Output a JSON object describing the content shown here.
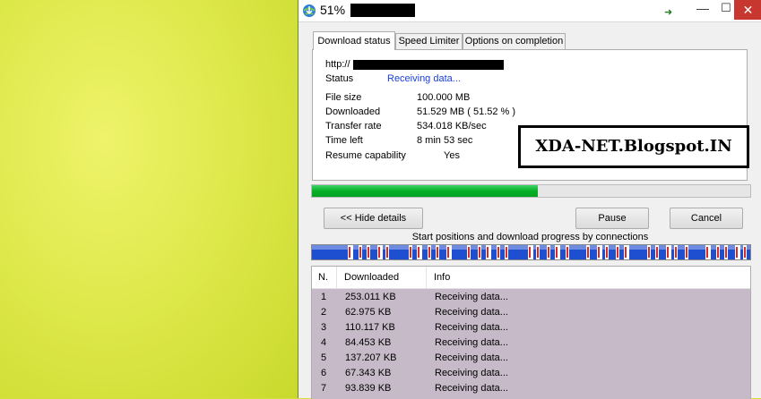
{
  "window": {
    "title_percent": "51%",
    "controls": {
      "minimize": "—",
      "maximize": "☐",
      "close": "✕"
    }
  },
  "tabs": [
    {
      "label": "Download status",
      "active": true
    },
    {
      "label": "Speed Limiter",
      "active": false
    },
    {
      "label": "Options on completion",
      "active": false
    }
  ],
  "details": {
    "url_prefix": "http://",
    "status_label": "Status",
    "status_value": "Receiving data...",
    "file_size_label": "File size",
    "file_size_value": "100.000  MB",
    "downloaded_label": "Downloaded",
    "downloaded_value": "51.529  MB  ( 51.52 % )",
    "transfer_rate_label": "Transfer rate",
    "transfer_rate_value": "534.018  KB/sec",
    "time_left_label": "Time left",
    "time_left_value": "8 min 53 sec",
    "resume_label": "Resume capability",
    "resume_value": "Yes"
  },
  "watermark": "XDA-NET.Blogspot.IN",
  "progress": {
    "fraction": 0.5152
  },
  "buttons": {
    "hide_details": "<< Hide details",
    "pause": "Pause",
    "cancel": "Cancel"
  },
  "connections": {
    "caption": "Start positions and download progress by connections",
    "table_headers": {
      "n": "N.",
      "downloaded": "Downloaded",
      "info": "Info"
    },
    "rows": [
      {
        "n": "1",
        "downloaded": "253.011  KB",
        "info": "Receiving data..."
      },
      {
        "n": "2",
        "downloaded": "62.975  KB",
        "info": "Receiving data..."
      },
      {
        "n": "3",
        "downloaded": "110.117  KB",
        "info": "Receiving data..."
      },
      {
        "n": "4",
        "downloaded": "84.453  KB",
        "info": "Receiving data..."
      },
      {
        "n": "5",
        "downloaded": "137.207  KB",
        "info": "Receiving data..."
      },
      {
        "n": "6",
        "downloaded": "67.343  KB",
        "info": "Receiving data..."
      },
      {
        "n": "7",
        "downloaded": "93.839  KB",
        "info": "Receiving data..."
      }
    ]
  },
  "colors": {
    "progress_green": "#06b025",
    "status_blue": "#1a3fd6",
    "close_red": "#c7372f",
    "list_background": "#c6bac8",
    "connection_blue": "#1f4fd1",
    "connection_red": "#d42a2a"
  },
  "icons": {
    "app": "idm-globe-icon",
    "tray": "green-arrow-icon"
  }
}
